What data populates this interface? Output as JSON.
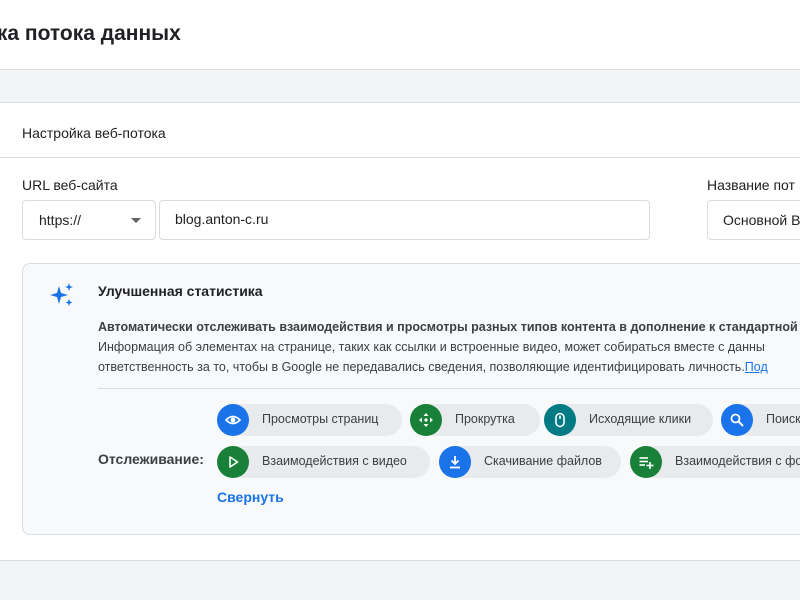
{
  "header": {
    "title": "йка потока данных"
  },
  "card": {
    "title": "Настройка веб-потока",
    "url_label": "URL веб-сайта",
    "protocol": "https://",
    "url_value": "blog.anton-c.ru",
    "stream_name_label": "Название пот",
    "stream_name_value": "Основной В"
  },
  "enhanced": {
    "title": "Улучшенная статистика",
    "desc_bold": "Автоматически отслеживать взаимодействия и просмотры разных типов контента в дополнение к стандартной с",
    "desc_line2": "Информация об элементах на странице, таких как ссылки и встроенные видео, может собираться вместе с данны",
    "desc_line3": "ответственность за то, чтобы в Google не передавались сведения, позволяющие идентифицировать личность.",
    "desc_link": "Под",
    "tracking_label": "Отслеживание:",
    "chips": [
      {
        "label": "Просмотры страниц",
        "icon": "eye-icon",
        "color": "#1a73e8"
      },
      {
        "label": "Прокрутка",
        "icon": "scroll-arrows-icon",
        "color": "#188038"
      },
      {
        "label": "Исходящие клики",
        "icon": "mouse-icon",
        "color": "#007b83"
      },
      {
        "label": "Поиск",
        "icon": "search-icon",
        "color": "#1a73e8"
      },
      {
        "label": "Взаимодействия с видео",
        "icon": "play-icon",
        "color": "#188038"
      },
      {
        "label": "Скачивание файлов",
        "icon": "download-icon",
        "color": "#1a73e8"
      },
      {
        "label": "Взаимодействия с фо",
        "icon": "form-icon",
        "color": "#188038"
      }
    ],
    "collapse": "Свернуть"
  }
}
